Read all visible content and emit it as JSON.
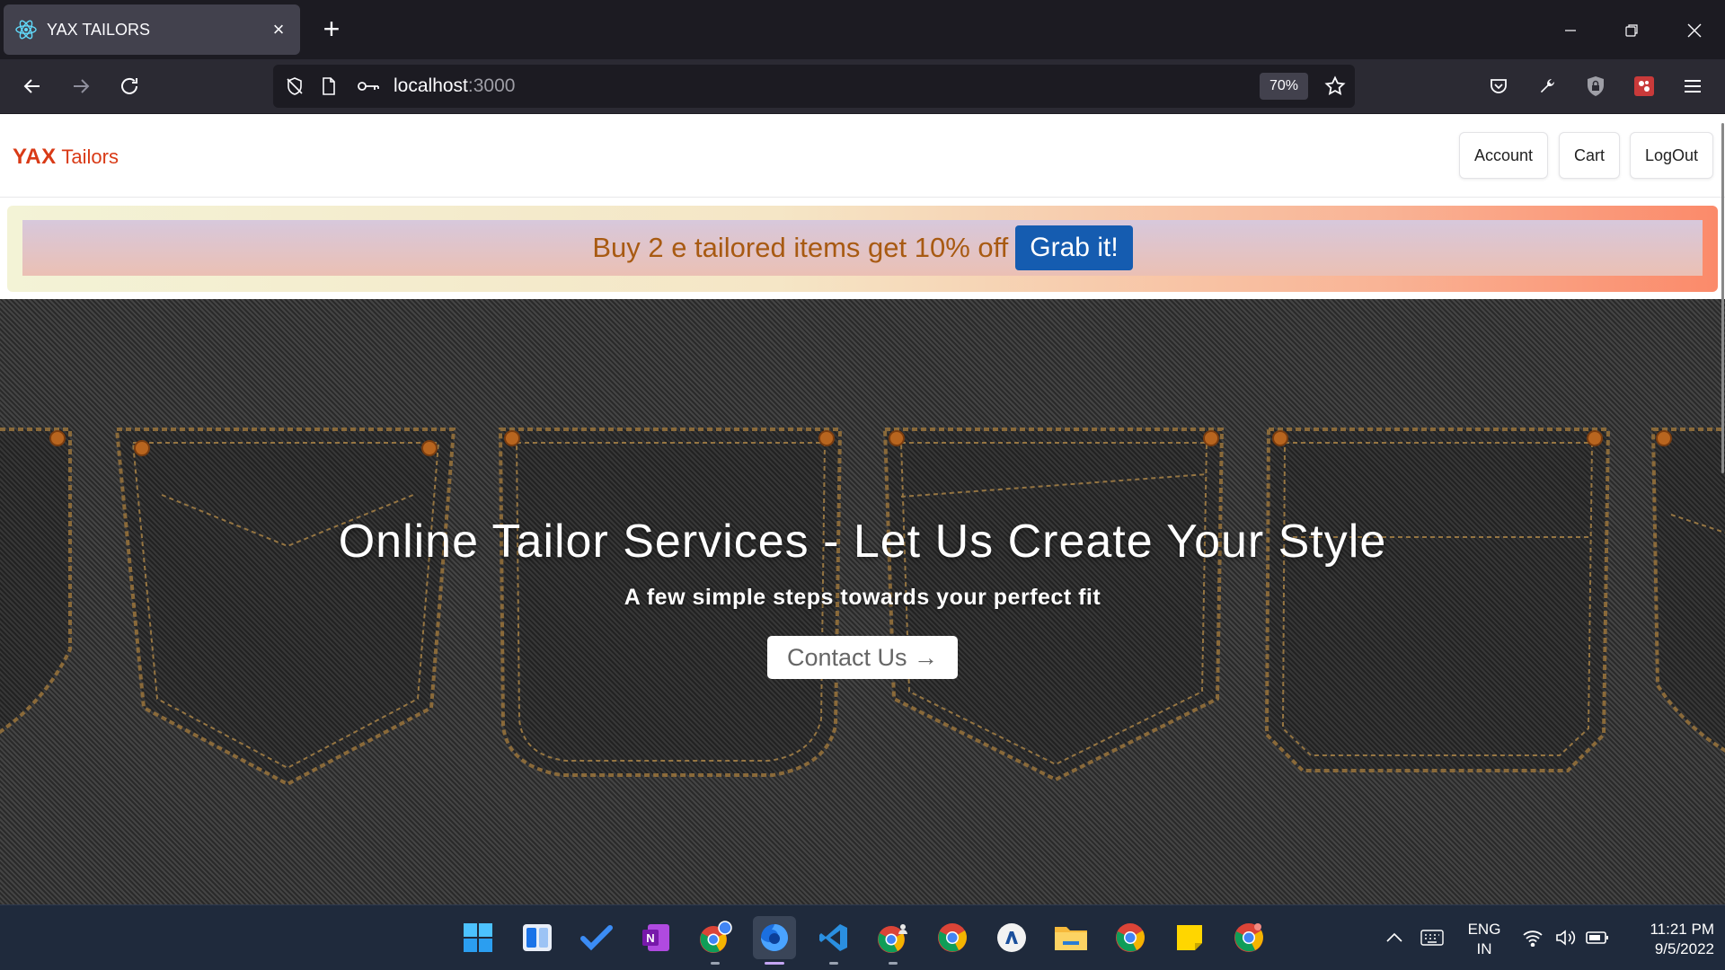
{
  "browser": {
    "tab_title": "YAX TAILORS",
    "url_host": "localhost",
    "url_port": ":3000",
    "zoom": "70%"
  },
  "site": {
    "brand_bold": "YAX",
    "brand_rest": " Tailors",
    "nav": [
      "Account",
      "Cart",
      "LogOut"
    ]
  },
  "promo": {
    "text": "Buy 2 e tailored items get 10% off",
    "cta": "Grab it!"
  },
  "hero": {
    "title": "Online Tailor Services - Let Us Create Your Style",
    "subtitle": "A few simple steps towards your perfect fit",
    "button": "Contact Us →"
  },
  "taskbar": {
    "lang_top": "ENG",
    "lang_bottom": "IN",
    "time": "11:21 PM",
    "date": "9/5/2022"
  },
  "colors": {
    "brand": "#d93a16",
    "promo_text": "#a85a12",
    "grab_button": "#155cb0"
  }
}
